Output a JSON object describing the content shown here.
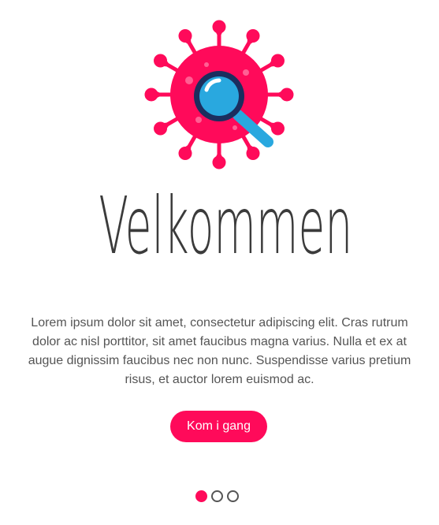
{
  "onboarding": {
    "logo_icon": "virus-magnifier-icon",
    "title": "Velkommen",
    "body": "Lorem ipsum dolor sit amet, consectetur adipiscing elit. Cras rutrum dolor ac nisl porttitor, sit amet faucibus magna varius. Nulla et ex at augue dignissim faucibus nec non nunc. Suspendisse varius pretium risus, et auctor lorem euismod ac.",
    "cta_label": "Kom i gang",
    "page_count": 3,
    "active_page": 1
  },
  "colors": {
    "accent": "#ff0a5a",
    "lens": "#29a8df",
    "text": "#555555",
    "title": "#3b3b3b"
  }
}
